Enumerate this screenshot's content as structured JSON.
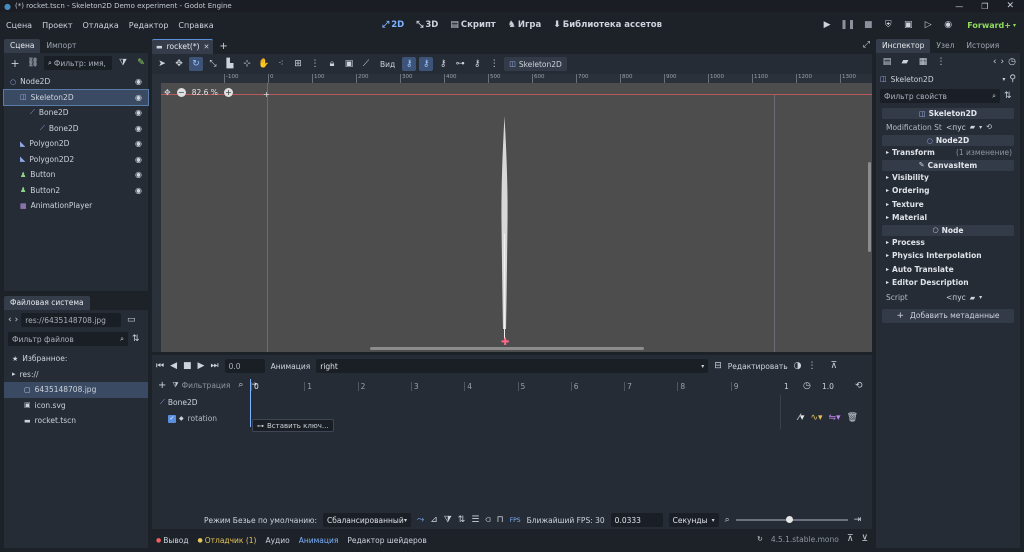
{
  "window": {
    "title": "(*) rocket.tscn - Skeleton2D Demo experiment - Godot Engine"
  },
  "menu": [
    "Сцена",
    "Проект",
    "Отладка",
    "Редактор",
    "Справка"
  ],
  "workspaces": [
    "2D",
    "3D",
    "Скрипт",
    "Игра",
    "Библиотека ассетов"
  ],
  "renderer": "Forward+",
  "scene_dock": {
    "tabs": [
      "Сцена",
      "Импорт"
    ],
    "filter_placeholder": "Фильтр: имя, т",
    "nodes": [
      {
        "name": "Node2D",
        "indent": 0,
        "icon": "○",
        "color": "#8fa8e8",
        "eye": true
      },
      {
        "name": "Skeleton2D",
        "indent": 1,
        "icon": "◫",
        "color": "#a2b6f2",
        "eye": true,
        "selected": true
      },
      {
        "name": "Bone2D",
        "indent": 2,
        "icon": "⟋",
        "color": "#8fb0f0",
        "eye": true
      },
      {
        "name": "Bone2D",
        "indent": 3,
        "icon": "⟋",
        "color": "#8fb0f0",
        "eye": true
      },
      {
        "name": "Polygon2D",
        "indent": 1,
        "icon": "◣",
        "color": "#8fa8e8",
        "eye": true
      },
      {
        "name": "Polygon2D2",
        "indent": 1,
        "icon": "◣",
        "color": "#8fa8e8",
        "eye": true
      },
      {
        "name": "Button",
        "indent": 1,
        "icon": "♟",
        "color": "#8ed48a",
        "eye": true
      },
      {
        "name": "Button2",
        "indent": 1,
        "icon": "♟",
        "color": "#8ed48a",
        "eye": true
      },
      {
        "name": "AnimationPlayer",
        "indent": 1,
        "icon": "▦",
        "color": "#c49aee",
        "eye": false
      }
    ]
  },
  "filesystem": {
    "tab": "Файловая система",
    "path": "res://6435148708.jpg",
    "filter_placeholder": "Фильтр файлов",
    "items": [
      {
        "name": "Избранное:",
        "indent": 0,
        "icon": "★"
      },
      {
        "name": "res://",
        "indent": 0,
        "icon": "▸"
      },
      {
        "name": "6435148708.jpg",
        "indent": 1,
        "icon": "▢",
        "selected": true
      },
      {
        "name": "icon.svg",
        "indent": 1,
        "icon": "▣"
      },
      {
        "name": "rocket.tscn",
        "indent": 1,
        "icon": "▬"
      }
    ]
  },
  "editor": {
    "scene_tab": "rocket(*)",
    "view_label": "Вид",
    "skeleton_button": "Skeleton2D",
    "zoom": "82.6 %",
    "ruler_labels": [
      "-100",
      "0",
      "100",
      "200",
      "300",
      "400",
      "500",
      "600",
      "700",
      "800",
      "900",
      "1000",
      "1100",
      "1200",
      "1300"
    ]
  },
  "animation": {
    "time": "0.0",
    "label": "Анимация",
    "name": "right",
    "edit": "Редактировать",
    "filter": "Фильтрация",
    "ticks": [
      "0",
      "1",
      "2",
      "3",
      "4",
      "5",
      "6",
      "7",
      "8",
      "9"
    ],
    "length_marker": "1",
    "length": "1.0",
    "track_node": "Bone2D",
    "track_prop": "rotation",
    "tooltip": "Вставить ключ...",
    "bezier_label": "Режим Безье по умолчанию:",
    "bezier_value": "Сбалансированный",
    "fps_label": "Ближайший FPS: 30",
    "step": "0.0333",
    "unit": "Секунды"
  },
  "bottom_tabs": [
    "Вывод",
    "Отладчик (1)",
    "Аудио",
    "Анимация",
    "Редактор шейдеров"
  ],
  "version": "4.5.1.stable.mono",
  "inspector": {
    "tabs": [
      "Инспектор",
      "Узел",
      "История"
    ],
    "object": "Skeleton2D",
    "filter_placeholder": "Фильтр свойств",
    "modification_label": "Modification Sta",
    "empty": "<пус",
    "class_skeleton": "Skeleton2D",
    "class_node2d": "Node2D",
    "transform": "Transform",
    "transform_note": "(1 изменение)",
    "class_canvas": "CanvasItem",
    "canvas_props": [
      "Visibility",
      "Ordering",
      "Texture",
      "Material"
    ],
    "class_node": "Node",
    "node_props": [
      "Process",
      "Physics Interpolation",
      "Auto Translate",
      "Editor Description"
    ],
    "script_label": "Script",
    "add_meta": "Добавить метаданные"
  }
}
